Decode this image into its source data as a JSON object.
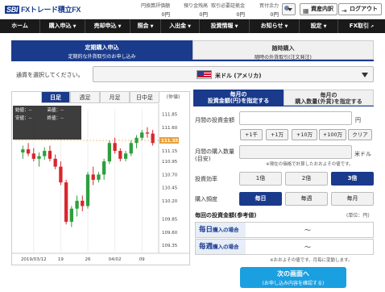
{
  "header": {
    "logo_brand": "SBI",
    "logo_text": "FXトレード積立FX",
    "stats": [
      {
        "label": "円換算評価額",
        "value": "0円"
      },
      {
        "label": "預り金残高",
        "value": "0円"
      },
      {
        "label": "取引必要証拠金",
        "value": "0円"
      },
      {
        "label": "買付余力",
        "value": "0円"
      }
    ],
    "assets_button": "資産内訳",
    "logout_button": "ログアウト"
  },
  "nav": {
    "items": [
      {
        "label": "ホーム",
        "caret": ""
      },
      {
        "label": "購入申込",
        "caret": "▼"
      },
      {
        "label": "売却申込",
        "caret": "▼"
      },
      {
        "label": "照会",
        "caret": "▼"
      },
      {
        "label": "入出金",
        "caret": "▼"
      },
      {
        "label": "投資情報",
        "caret": "▼"
      },
      {
        "label": "お知らせ",
        "caret": "▼"
      },
      {
        "label": "設定",
        "caret": "▼"
      },
      {
        "label": "FX取引",
        "caret": "⇗"
      }
    ]
  },
  "tabs": {
    "active": {
      "title": "定期購入申込",
      "sub": "定期的な外貨取引のお申し込み"
    },
    "inactive": {
      "title": "随時購入",
      "sub": "随時の外貨取引(注文発注)"
    }
  },
  "currency": {
    "label": "通貨を選択してください。",
    "selected": "米ドル (アメリカ)"
  },
  "chart": {
    "tabs": [
      "日足",
      "週足",
      "月足",
      "日中足"
    ],
    "active_tab": "日足",
    "unit_label": "(仲値)",
    "ohlc": {
      "open": "始値：",
      "high": "高値：",
      "low": "安値：",
      "close": "終値：",
      "open_v": "--",
      "high_v": "--",
      "low_v": "--",
      "close_v": "--"
    },
    "current_price": "111.35"
  },
  "chart_data": {
    "type": "candlestick",
    "y_ticks": [
      "111.85",
      "111.60",
      "111.35",
      "111.15",
      "110.95",
      "110.70",
      "110.45",
      "110.20",
      "109.85",
      "109.60",
      "109.35"
    ],
    "ylim": [
      109.2,
      111.95
    ],
    "x_ticks": [
      "2019/03/12",
      "19",
      "26",
      "04/02",
      "09"
    ],
    "candles": [
      {
        "o": 111.12,
        "h": 111.25,
        "l": 111.0,
        "c": 111.18
      },
      {
        "o": 111.18,
        "h": 111.3,
        "l": 111.05,
        "c": 111.1
      },
      {
        "o": 111.1,
        "h": 111.2,
        "l": 110.95,
        "c": 111.0
      },
      {
        "o": 111.0,
        "h": 111.12,
        "l": 110.85,
        "c": 111.05
      },
      {
        "o": 111.05,
        "h": 111.22,
        "l": 110.98,
        "c": 111.15
      },
      {
        "o": 111.15,
        "h": 111.25,
        "l": 110.95,
        "c": 111.0
      },
      {
        "o": 111.0,
        "h": 111.08,
        "l": 110.8,
        "c": 110.85
      },
      {
        "o": 110.85,
        "h": 110.95,
        "l": 110.5,
        "c": 110.55
      },
      {
        "o": 110.55,
        "h": 110.6,
        "l": 109.75,
        "c": 109.8
      },
      {
        "o": 109.8,
        "h": 110.1,
        "l": 109.7,
        "c": 110.05
      },
      {
        "o": 110.05,
        "h": 110.3,
        "l": 109.9,
        "c": 110.2
      },
      {
        "o": 110.2,
        "h": 110.3,
        "l": 110.0,
        "c": 110.1
      },
      {
        "o": 110.1,
        "h": 110.75,
        "l": 110.05,
        "c": 110.7
      },
      {
        "o": 110.7,
        "h": 110.85,
        "l": 110.5,
        "c": 110.6
      },
      {
        "o": 110.6,
        "h": 110.75,
        "l": 110.55,
        "c": 110.7
      },
      {
        "o": 110.7,
        "h": 111.0,
        "l": 110.6,
        "c": 110.95
      },
      {
        "o": 110.95,
        "h": 111.35,
        "l": 110.9,
        "c": 111.3
      },
      {
        "o": 111.3,
        "h": 111.4,
        "l": 111.1,
        "c": 111.15
      },
      {
        "o": 111.15,
        "h": 111.2,
        "l": 110.95,
        "c": 111.0
      },
      {
        "o": 111.0,
        "h": 111.15,
        "l": 110.95,
        "c": 111.1
      },
      {
        "o": 111.1,
        "h": 111.35,
        "l": 111.05,
        "c": 111.3
      },
      {
        "o": 111.3,
        "h": 111.45,
        "l": 111.2,
        "c": 111.4
      },
      {
        "o": 111.4,
        "h": 111.55,
        "l": 111.35,
        "c": 111.5
      },
      {
        "o": 111.5,
        "h": 111.6,
        "l": 111.4,
        "c": 111.48
      },
      {
        "o": 111.48,
        "h": 111.55,
        "l": 111.25,
        "c": 111.3
      }
    ],
    "up_color": "#2e9e3e",
    "down_color": "#d9262e",
    "current_price": 111.35
  },
  "form": {
    "tab_active": {
      "line1": "毎月の",
      "line2": "投資金額(円)を指定する"
    },
    "tab_inactive": {
      "line1": "毎月の",
      "line2": "購入数量(外貨)を指定する"
    },
    "monthly_amount_label": "月間の投資金額",
    "yen_unit": "円",
    "quick_buttons": [
      "+1千",
      "+1万",
      "+10万",
      "+100万",
      "クリア"
    ],
    "qty_label_1": "月間の購入数量",
    "qty_label_2": "(目安)",
    "qty_unit": "米ドル",
    "qty_note": "※現在の価格で計算したおおよその値です。",
    "leverage_label": "投資効率",
    "leverage_options": [
      "1倍",
      "2倍",
      "3倍"
    ],
    "leverage_selected": 2,
    "freq_label": "購入頻度",
    "freq_options": [
      "毎日",
      "毎週",
      "毎月"
    ],
    "freq_selected": 0,
    "per_time_title": "毎回の投資金額(参考値)",
    "per_time_unit": "(単位：円)",
    "daily_row": {
      "big": "毎日",
      "small": "購入の場合",
      "value": "〜"
    },
    "weekly_row": {
      "big": "毎週",
      "small": "購入の場合",
      "value": "〜"
    },
    "bottom_note": "※おおよその値です。月毎に変動します。",
    "next_button": {
      "main": "次の画面へ",
      "sub": "(お申し込み内容を確認する)"
    }
  }
}
